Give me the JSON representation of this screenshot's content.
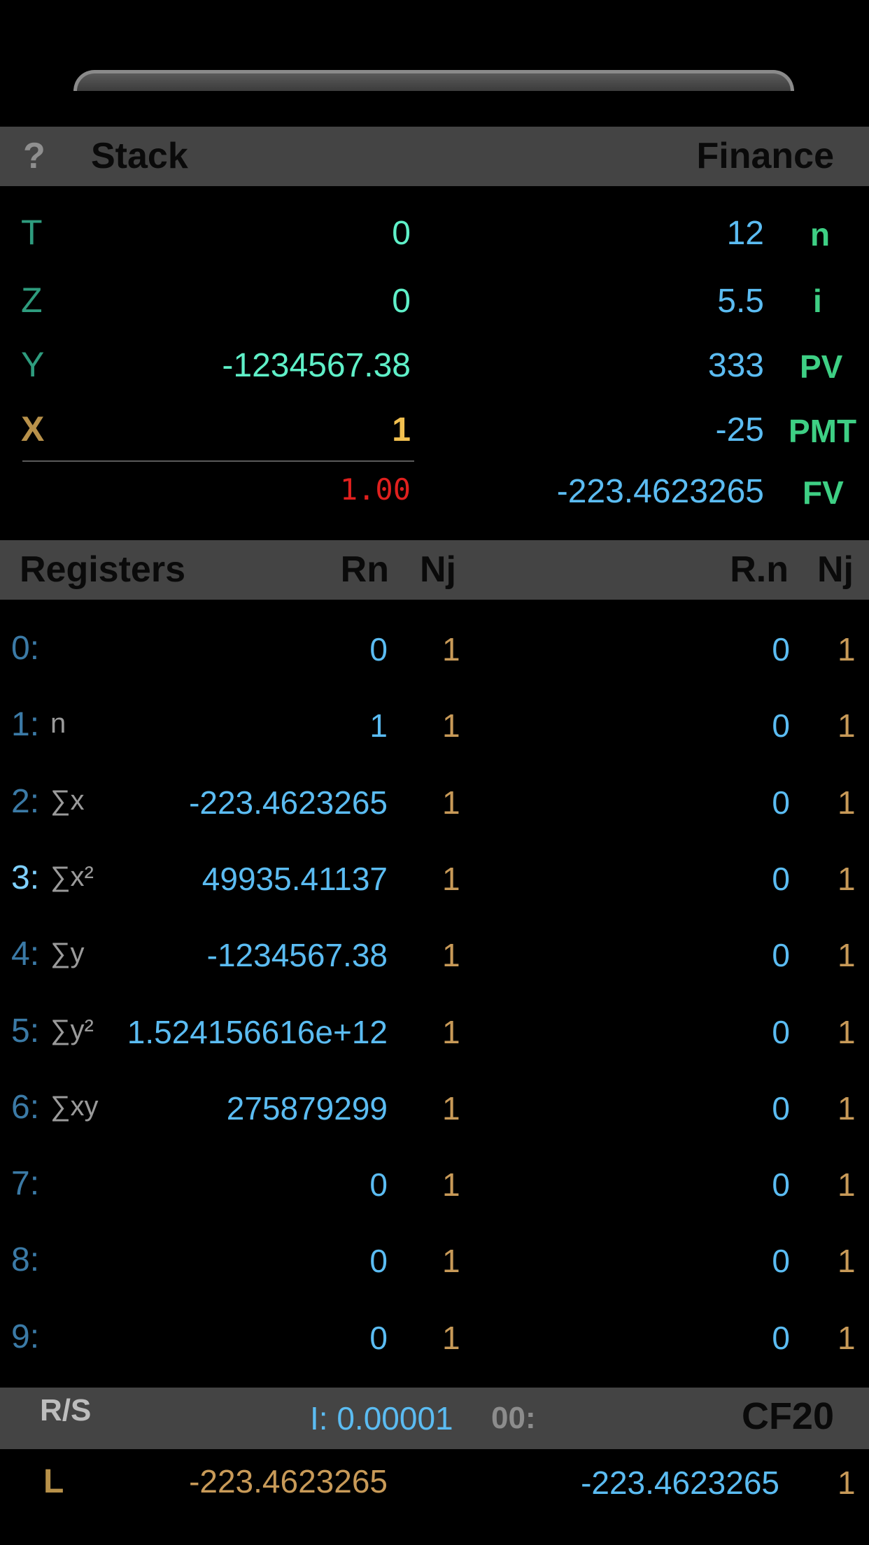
{
  "header": {
    "help": "?",
    "stack_title": "Stack",
    "finance_title": "Finance"
  },
  "stack": [
    {
      "label": "T",
      "value": "0"
    },
    {
      "label": "Z",
      "value": "0"
    },
    {
      "label": "Y",
      "value": "-1234567.38"
    },
    {
      "label": "X",
      "value": "1"
    }
  ],
  "display": "1.00",
  "finance": [
    {
      "value": "12",
      "label": "n"
    },
    {
      "value": "5.5",
      "label": "i"
    },
    {
      "value": "333",
      "label": "PV"
    },
    {
      "value": "-25",
      "label": "PMT"
    },
    {
      "value": "-223.4623265",
      "label": "FV"
    }
  ],
  "registers_header": {
    "title": "Registers",
    "rn": "Rn",
    "nj": "Nj",
    "rdn": "R.n",
    "nj2": "Nj"
  },
  "registers": [
    {
      "idx": "0:",
      "sym": "",
      "rn": "0",
      "nj": "1",
      "rdn": "0",
      "nj2": "1"
    },
    {
      "idx": "1:",
      "sym": "n",
      "rn": "1",
      "nj": "1",
      "rdn": "0",
      "nj2": "1"
    },
    {
      "idx": "2:",
      "sym": "∑x",
      "rn": "-223.4623265",
      "nj": "1",
      "rdn": "0",
      "nj2": "1"
    },
    {
      "idx": "3:",
      "sym": "∑x²",
      "rn": "49935.41137",
      "nj": "1",
      "rdn": "0",
      "nj2": "1"
    },
    {
      "idx": "4:",
      "sym": "∑y",
      "rn": "-1234567.38",
      "nj": "1",
      "rdn": "0",
      "nj2": "1"
    },
    {
      "idx": "5:",
      "sym": "∑y²",
      "rn": "1.524156616e+12",
      "nj": "1",
      "rdn": "0",
      "nj2": "1"
    },
    {
      "idx": "6:",
      "sym": "∑xy",
      "rn": "275879299",
      "nj": "1",
      "rdn": "0",
      "nj2": "1"
    },
    {
      "idx": "7:",
      "sym": "",
      "rn": "0",
      "nj": "1",
      "rdn": "0",
      "nj2": "1"
    },
    {
      "idx": "8:",
      "sym": "",
      "rn": "0",
      "nj": "1",
      "rdn": "0",
      "nj2": "1"
    },
    {
      "idx": "9:",
      "sym": "",
      "rn": "0",
      "nj": "1",
      "rdn": "0",
      "nj2": "1"
    }
  ],
  "program_bar": {
    "rs": "R/S",
    "interest": "I: 0.00001",
    "step": "00:",
    "cf": "CF20"
  },
  "last_x": {
    "label": "L",
    "value": "-223.4623265",
    "value2": "-223.4623265",
    "count": "1"
  },
  "colors": {
    "stack_label": "#2e9c7e",
    "stack_value": "#5ff0c8",
    "x_label": "#b8914a",
    "x_value": "#f2c050",
    "display": "#e0201e",
    "finance_value": "#5bbcf2",
    "finance_label": "#3ecf84",
    "register_index": "#3b7aa6",
    "bar": "#444444"
  }
}
